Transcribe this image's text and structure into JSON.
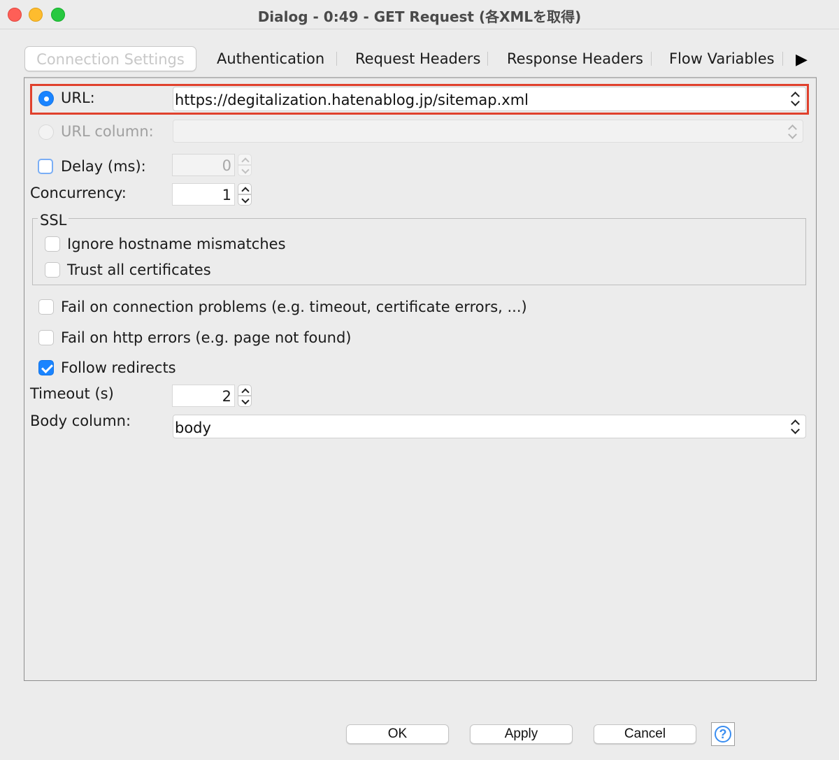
{
  "window": {
    "title": "Dialog - 0:49 - GET Request (各XMLを取得)"
  },
  "tabs": {
    "items": [
      {
        "label": "Connection Settings",
        "active": true
      },
      {
        "label": "Authentication",
        "active": false
      },
      {
        "label": "Request Headers",
        "active": false
      },
      {
        "label": "Response Headers",
        "active": false
      },
      {
        "label": "Flow Variables",
        "active": false
      }
    ],
    "more_icon": "triangle-right-icon"
  },
  "connection": {
    "url_label": "URL:",
    "url_value": "https://degitalization.hatenablog.jp/sitemap.xml",
    "url_selected": true,
    "url_column_label": "URL column:",
    "url_column_value": "",
    "delay_label": "Delay (ms):",
    "delay_checked": false,
    "delay_value": "0",
    "concurrency_label": "Concurrency:",
    "concurrency_value": "1",
    "ssl": {
      "title": "SSL",
      "ignore_hostname_label": "Ignore hostname mismatches",
      "ignore_hostname_checked": false,
      "trust_all_label": "Trust all certificates",
      "trust_all_checked": false
    },
    "fail_connection_label": "Fail on connection problems (e.g. timeout, certificate errors, ...)",
    "fail_connection_checked": false,
    "fail_http_label": "Fail on http errors (e.g. page not found)",
    "fail_http_checked": false,
    "follow_redirects_label": "Follow redirects",
    "follow_redirects_checked": true,
    "timeout_label": "Timeout (s)",
    "timeout_value": "2",
    "body_column_label": "Body column:",
    "body_column_value": "body"
  },
  "buttons": {
    "ok": "OK",
    "apply": "Apply",
    "cancel": "Cancel",
    "help_icon": "question-mark-icon"
  },
  "colors": {
    "accent": "#1a84ff",
    "highlight_border": "#e0412d"
  }
}
